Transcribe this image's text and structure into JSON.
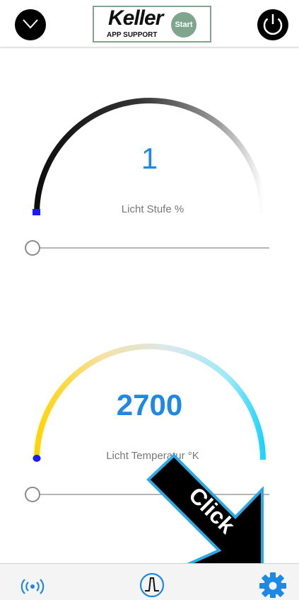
{
  "header": {
    "logo": {
      "title": "Keller",
      "subtitle": "APP SUPPORT",
      "start_label": "Start",
      "border_color": "#7fa68d"
    },
    "clock_icon": "clock-icon",
    "power_icon": "power-icon"
  },
  "controls": [
    {
      "id": "light-level",
      "value": "1",
      "label": "Licht Stufe %",
      "slider_fraction": 0.0,
      "gauge_colors": [
        "#111111",
        "#ffffff"
      ]
    },
    {
      "id": "light-temperature",
      "value": "2700",
      "label": "Licht Temperatur °K",
      "slider_fraction": 0.0,
      "gauge_colors": [
        "#ffd400",
        "#f5e7b5",
        "#c9e6f2",
        "#29d4ff"
      ]
    }
  ],
  "overlay": {
    "label": "Click"
  },
  "footer": {
    "items": [
      {
        "name": "broadcast",
        "icon": "broadcast-icon"
      },
      {
        "name": "filter",
        "icon": "pulse-circle-icon"
      },
      {
        "name": "settings",
        "icon": "gear-icon"
      }
    ],
    "accent": "#1e88e5"
  }
}
